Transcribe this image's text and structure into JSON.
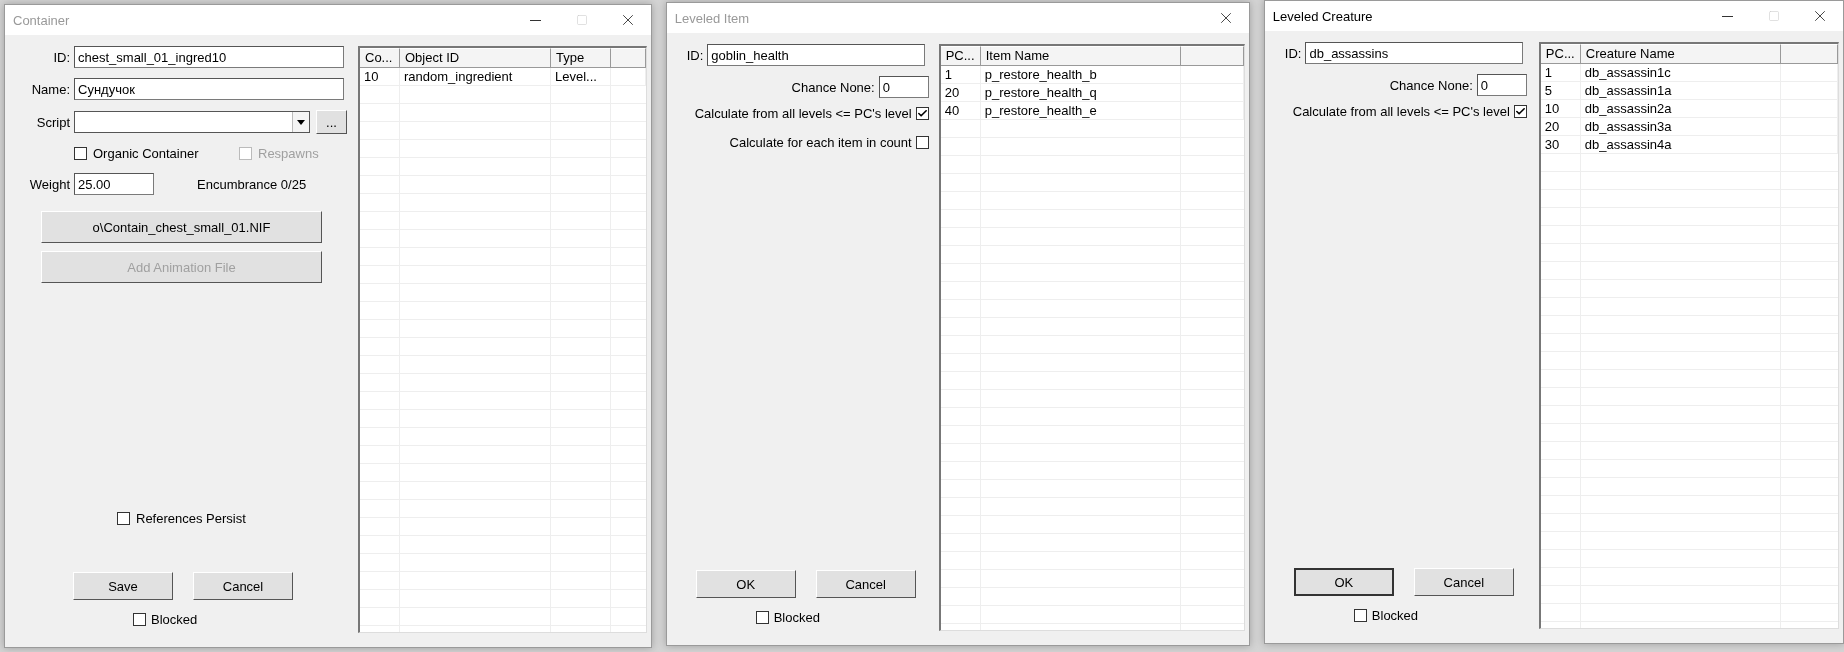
{
  "windows": [
    {
      "kind": "container",
      "title": "Container",
      "active": false,
      "minimize_maximize": true,
      "fields": [
        {
          "kind": "text",
          "label": "ID:",
          "value": "chest_small_01_ingred10"
        },
        {
          "kind": "text",
          "label": "Name:",
          "value": "Сундучок"
        },
        {
          "kind": "script",
          "label": "Script",
          "browse": "..."
        }
      ],
      "options": [
        {
          "label": "Organic Container",
          "checked": false,
          "disabled": false
        },
        {
          "label": "Respawns",
          "checked": false,
          "disabled": true
        }
      ],
      "weight": {
        "label": "Weight",
        "value": "25.00"
      },
      "encumbrance": "Encumbrance 0/25",
      "file_buttons": [
        {
          "label": "o\\Contain_chest_small_01.NIF",
          "disabled": false
        },
        {
          "label": "Add Animation File",
          "disabled": true
        }
      ],
      "persist": {
        "label": "References Persist",
        "checked": false
      },
      "table": {
        "columns": [
          "Co...",
          "Object ID",
          "Type"
        ],
        "rows": [
          [
            "10",
            "random_ingredient",
            "Level..."
          ]
        ]
      },
      "buttons": [
        {
          "label": "Save",
          "default": false
        },
        {
          "label": "Cancel",
          "default": false
        }
      ],
      "blocked": {
        "label": "Blocked",
        "checked": false
      }
    },
    {
      "kind": "leveled",
      "title": "Leveled Item",
      "active": false,
      "minimize_maximize": false,
      "id": {
        "label": "ID:",
        "value": "goblin_health"
      },
      "chance": {
        "label": "Chance None:",
        "value": "0"
      },
      "checks": [
        {
          "label": "Calculate from all levels <= PC's level",
          "checked": true
        },
        {
          "label": "Calculate for each item in count",
          "checked": false
        }
      ],
      "table": {
        "columns": [
          "PC...",
          "Item Name"
        ],
        "rows": [
          [
            "1",
            "p_restore_health_b"
          ],
          [
            "20",
            "p_restore_health_q"
          ],
          [
            "40",
            "p_restore_health_e"
          ]
        ]
      },
      "buttons": [
        {
          "label": "OK",
          "default": false
        },
        {
          "label": "Cancel",
          "default": false
        }
      ],
      "blocked": {
        "label": "Blocked",
        "checked": false
      }
    },
    {
      "kind": "leveled",
      "title": "Leveled Creature",
      "active": true,
      "minimize_maximize": true,
      "id": {
        "label": "ID:",
        "value": "db_assassins"
      },
      "chance": {
        "label": "Chance None:",
        "value": "0"
      },
      "checks": [
        {
          "label": "Calculate from all levels <= PC's level",
          "checked": true
        }
      ],
      "table": {
        "columns": [
          "PC...",
          "Creature Name"
        ],
        "rows": [
          [
            "1",
            "db_assassin1c"
          ],
          [
            "5",
            "db_assassin1a"
          ],
          [
            "10",
            "db_assassin2a"
          ],
          [
            "20",
            "db_assassin3a"
          ],
          [
            "30",
            "db_assassin4a"
          ]
        ]
      },
      "buttons": [
        {
          "label": "OK",
          "default": true
        },
        {
          "label": "Cancel",
          "default": false
        }
      ],
      "blocked": {
        "label": "Blocked",
        "checked": false
      }
    }
  ]
}
